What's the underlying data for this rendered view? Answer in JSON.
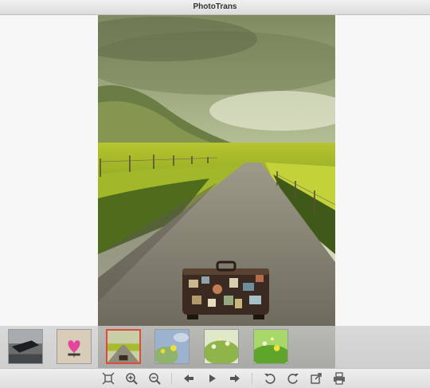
{
  "window": {
    "title": "PhotoTrans"
  },
  "viewer": {
    "image_alt": "photo"
  },
  "filmstrip": {
    "thumbnails": [
      {
        "selected": false
      },
      {
        "selected": false
      },
      {
        "selected": true
      },
      {
        "selected": false
      },
      {
        "selected": false
      },
      {
        "selected": false
      }
    ]
  },
  "toolbar": {
    "buttons": [
      {
        "icon": "fit-screen-icon"
      },
      {
        "icon": "zoom-in-icon"
      },
      {
        "icon": "zoom-out-icon"
      },
      {
        "icon": "previous-icon"
      },
      {
        "icon": "play-icon"
      },
      {
        "icon": "next-icon"
      },
      {
        "icon": "rotate-left-icon"
      },
      {
        "icon": "rotate-right-icon"
      },
      {
        "icon": "export-icon"
      },
      {
        "icon": "print-icon"
      }
    ]
  },
  "colors": {
    "selection_border": "#e14a3b"
  }
}
